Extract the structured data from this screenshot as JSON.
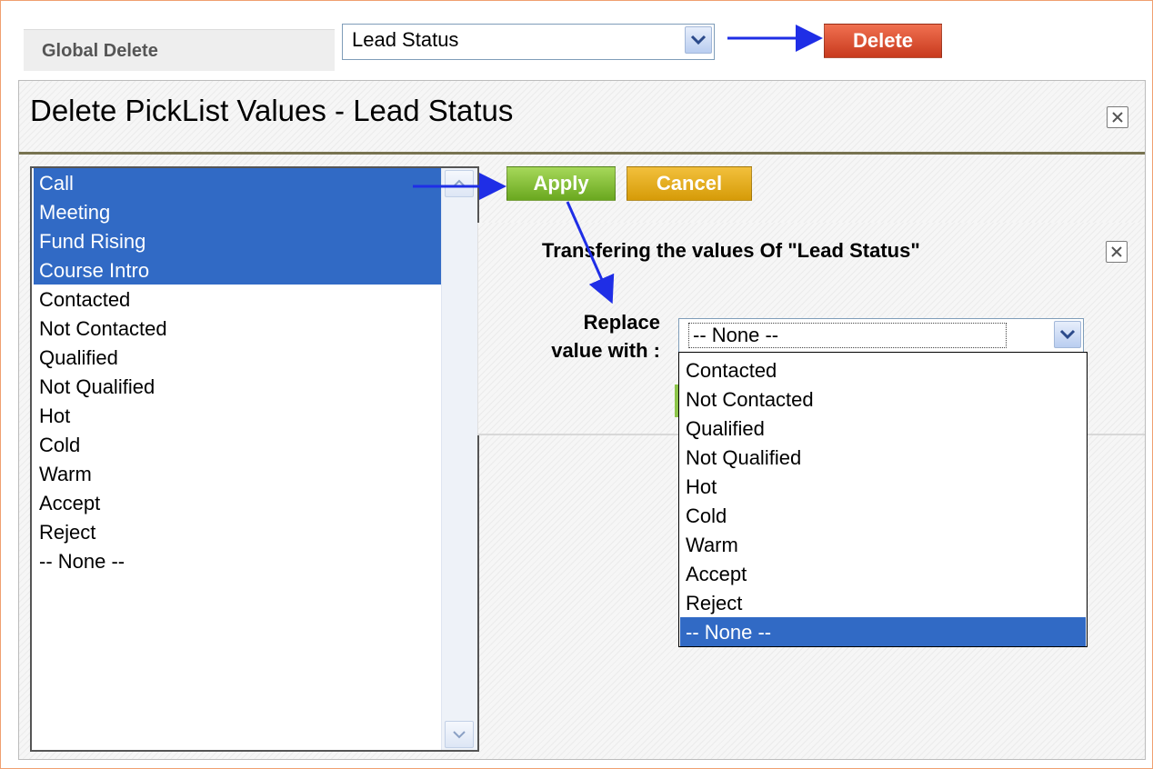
{
  "header": {
    "label": "Global Delete",
    "picklist_selected": "Lead Status",
    "delete_label": "Delete"
  },
  "panel": {
    "title": "Delete PickList Values - Lead Status",
    "apply_label": "Apply",
    "cancel_label": "Cancel"
  },
  "list": {
    "items": [
      {
        "label": "Call",
        "selected": true
      },
      {
        "label": "Meeting",
        "selected": true
      },
      {
        "label": "Fund Rising",
        "selected": true
      },
      {
        "label": "Course Intro",
        "selected": true
      },
      {
        "label": "Contacted",
        "selected": false
      },
      {
        "label": "Not Contacted",
        "selected": false
      },
      {
        "label": "Qualified",
        "selected": false
      },
      {
        "label": "Not Qualified",
        "selected": false
      },
      {
        "label": "Hot",
        "selected": false
      },
      {
        "label": "Cold",
        "selected": false
      },
      {
        "label": "Warm",
        "selected": false
      },
      {
        "label": "Accept",
        "selected": false
      },
      {
        "label": "Reject",
        "selected": false
      },
      {
        "label": "-- None --",
        "selected": false
      }
    ]
  },
  "transfer": {
    "title": "Transfering the values Of \"Lead Status\"",
    "replace_label_line1": "Replace",
    "replace_label_line2": "value with :",
    "replace_selected": "-- None --",
    "options": [
      {
        "label": "Contacted",
        "selected": false
      },
      {
        "label": "Not Contacted",
        "selected": false
      },
      {
        "label": "Qualified",
        "selected": false
      },
      {
        "label": "Not Qualified",
        "selected": false
      },
      {
        "label": "Hot",
        "selected": false
      },
      {
        "label": "Cold",
        "selected": false
      },
      {
        "label": "Warm",
        "selected": false
      },
      {
        "label": "Accept",
        "selected": false
      },
      {
        "label": "Reject",
        "selected": false
      },
      {
        "label": "-- None --",
        "selected": true
      }
    ]
  },
  "colors": {
    "selection": "#316ac5",
    "delete_button": "#d9482a",
    "apply_button": "#7fbc2e",
    "cancel_button": "#e2a918",
    "annotation_arrow": "#1f2ee6"
  },
  "icons": {
    "select_arrow": "chevron-down-icon",
    "close": "close-icon",
    "scroll_up": "scroll-up-icon",
    "scroll_down": "scroll-down-icon",
    "annotation": "arrow-icon"
  }
}
